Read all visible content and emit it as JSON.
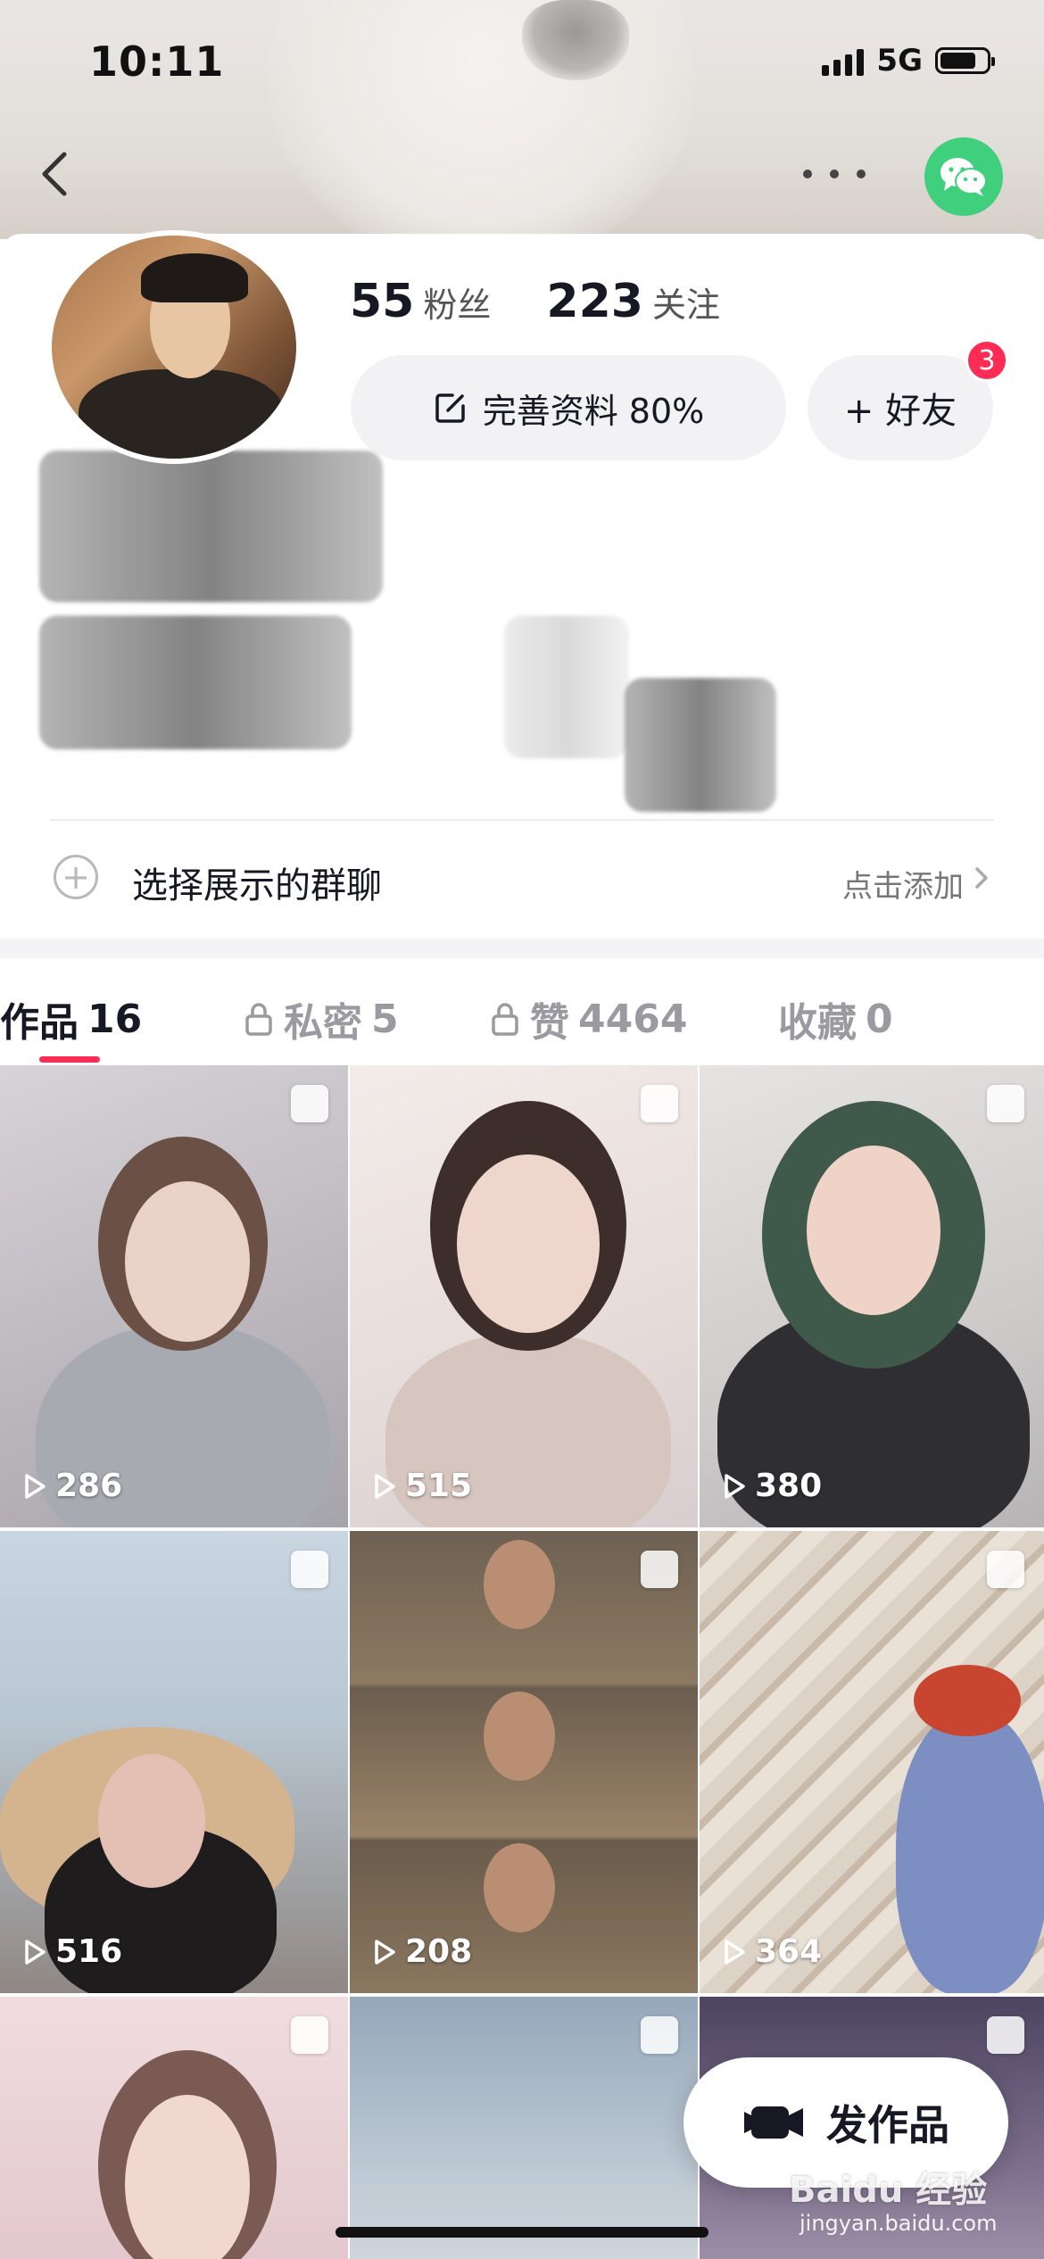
{
  "status_bar": {
    "time": "10:11",
    "network": "5G"
  },
  "header": {
    "back_icon": "chevron-left-icon",
    "more_icon": "ellipsis-icon",
    "share_icon": "wechat-icon",
    "share_color": "#3FCF7D"
  },
  "profile": {
    "followers_count": "55",
    "followers_label": "粉丝",
    "following_count": "223",
    "following_label": "关注",
    "edit_button_label": "完善资料 80%",
    "add_friend_label": "+ 好友",
    "friend_badge": "3"
  },
  "group_chat": {
    "title": "选择展示的群聊",
    "action": "点击添加"
  },
  "tabs": [
    {
      "label": "作品",
      "count": "16",
      "locked": false,
      "active": true
    },
    {
      "label": "私密",
      "count": "5",
      "locked": true,
      "active": false
    },
    {
      "label": "赞",
      "count": "4464",
      "locked": true,
      "active": false
    },
    {
      "label": "收藏",
      "count": "0",
      "locked": false,
      "active": false
    }
  ],
  "videos": [
    {
      "plays": "286"
    },
    {
      "plays": "515"
    },
    {
      "plays": "380"
    },
    {
      "plays": "516"
    },
    {
      "plays": "208"
    },
    {
      "plays": "364"
    }
  ],
  "publish_button": {
    "label": "发作品",
    "icon": "video-camera-icon"
  },
  "watermark": {
    "brand": "Baidu 经验",
    "url": "jingyan.baidu.com"
  },
  "colors": {
    "accent": "#FE2C55",
    "background": "#FFFFFF"
  }
}
